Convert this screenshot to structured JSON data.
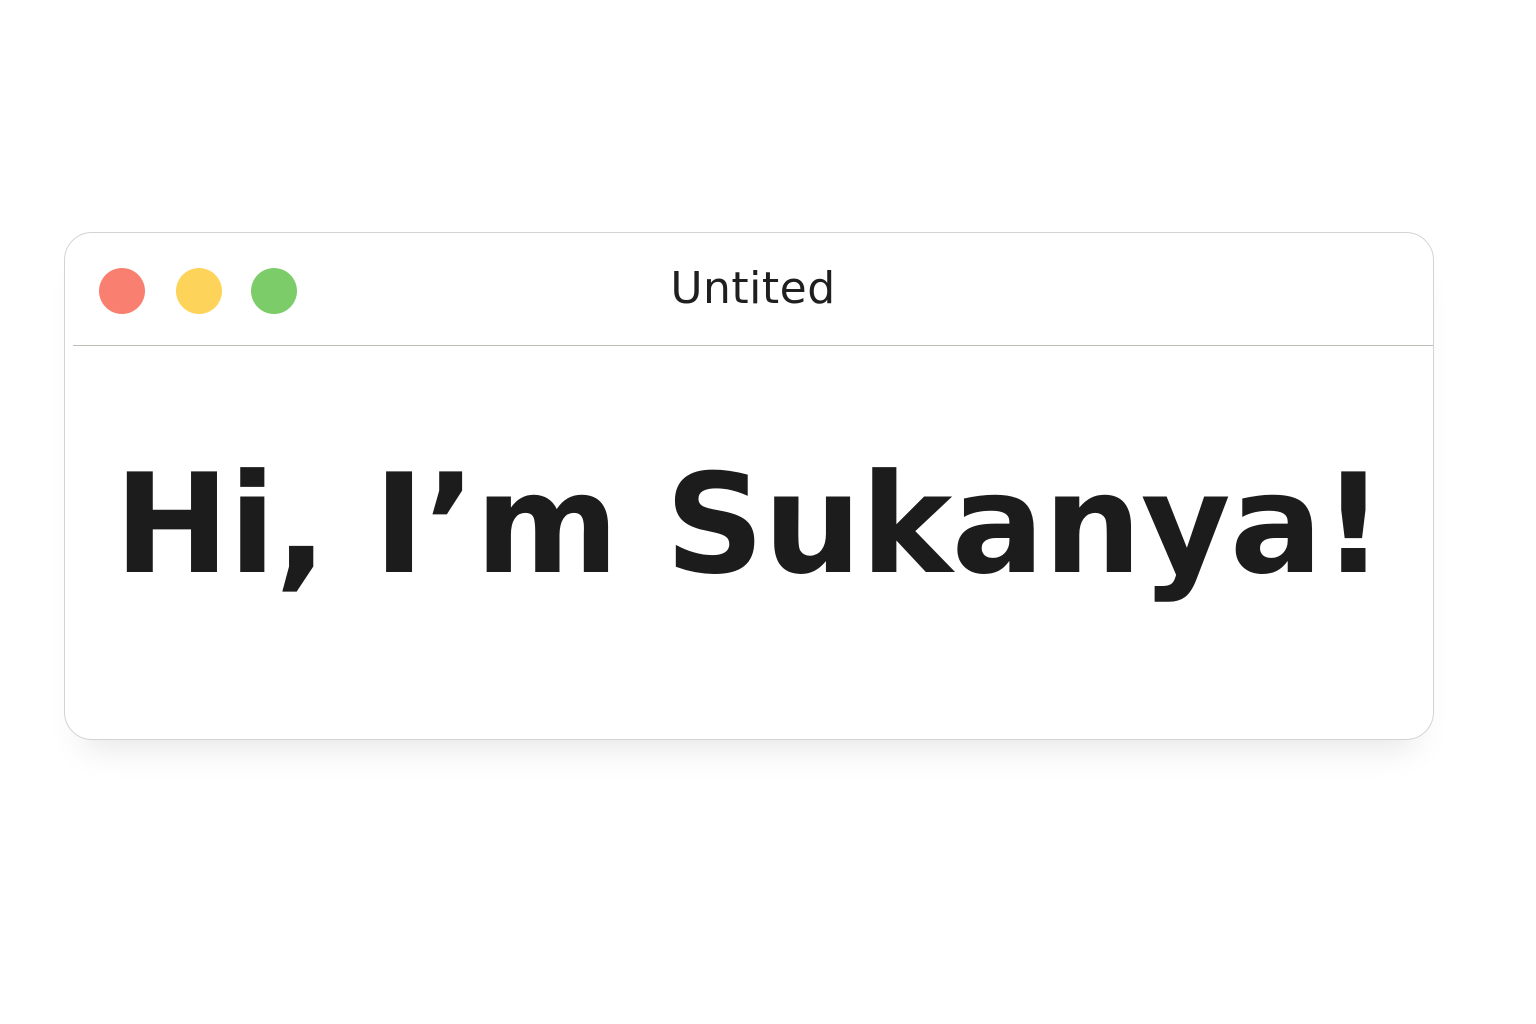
{
  "window": {
    "title": "Untited",
    "controls": {
      "close": {
        "icon": "close-dot-icon",
        "color": "#f98070"
      },
      "minimize": {
        "icon": "minimize-dot-icon",
        "color": "#fdd35a"
      },
      "zoom": {
        "icon": "zoom-dot-icon",
        "color": "#7ccd6a"
      }
    }
  },
  "content": {
    "greeting": "Hi, I’m Sukanya!"
  }
}
